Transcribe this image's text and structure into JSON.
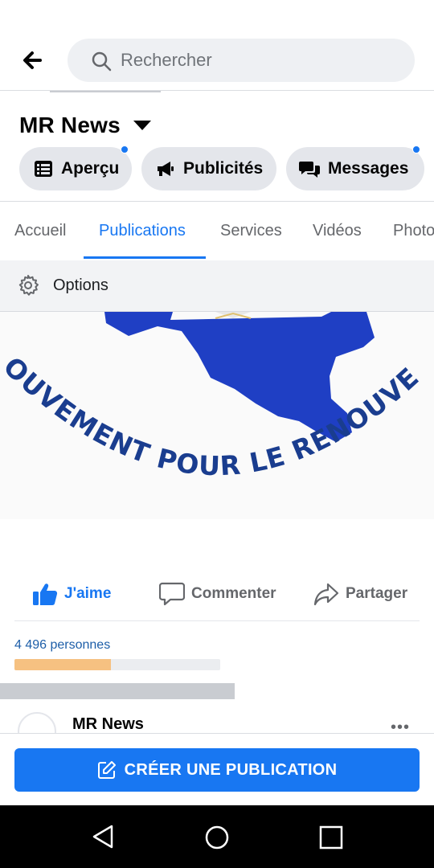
{
  "search": {
    "placeholder": "Rechercher"
  },
  "page": {
    "title": "MR News"
  },
  "quick_actions": [
    {
      "label": "Aperçu",
      "icon": "list-icon",
      "has_notification": true
    },
    {
      "label": "Publicités",
      "icon": "megaphone-icon",
      "has_notification": false
    },
    {
      "label": "Messages",
      "icon": "chat-bubbles-icon",
      "has_notification": true
    }
  ],
  "tabs": [
    {
      "label": "Accueil",
      "active": false
    },
    {
      "label": "Publications",
      "active": true
    },
    {
      "label": "Services",
      "active": false
    },
    {
      "label": "Vidéos",
      "active": false
    },
    {
      "label": "Photo",
      "active": false
    }
  ],
  "options": {
    "label": "Options",
    "icon": "gear-icon"
  },
  "post": {
    "image_text": "MOUVEMENT POUR LE RENOUVEAU",
    "actions": {
      "like": "J'aime",
      "comment": "Commenter",
      "share": "Partager"
    },
    "reach_label": "4 496 personnes",
    "reach_progress": 0.47
  },
  "next_post": {
    "author": "MR News",
    "more": "•••"
  },
  "create_button": {
    "label": "CRÉER UNE PUBLICATION"
  },
  "colors": {
    "accent": "#1877f2",
    "logo_blue": "#1f3fc4",
    "logo_text": "#1a3d8f",
    "reach_fill": "#f6c181"
  }
}
